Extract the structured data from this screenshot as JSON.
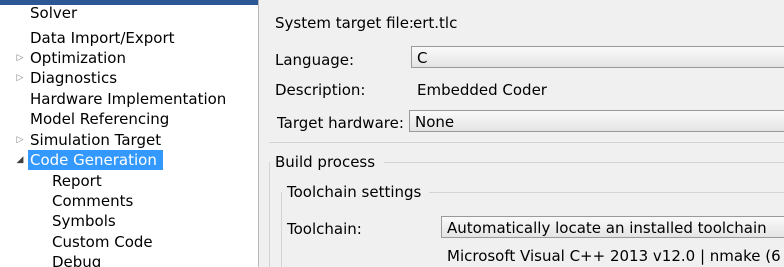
{
  "tree": {
    "items": [
      {
        "label": "Solver",
        "expander": "",
        "indent": 0
      },
      {
        "label": "Data Import/Export",
        "expander": "",
        "indent": 0
      },
      {
        "label": "Optimization",
        "expander": "collapsed",
        "indent": 0
      },
      {
        "label": "Diagnostics",
        "expander": "collapsed",
        "indent": 0
      },
      {
        "label": "Hardware Implementation",
        "expander": "",
        "indent": 0
      },
      {
        "label": "Model Referencing",
        "expander": "",
        "indent": 0
      },
      {
        "label": "Simulation Target",
        "expander": "collapsed",
        "indent": 0
      },
      {
        "label": "Code Generation",
        "expander": "expanded",
        "indent": 0,
        "selected": true
      },
      {
        "label": "Report",
        "expander": "",
        "indent": 1
      },
      {
        "label": "Comments",
        "expander": "",
        "indent": 1
      },
      {
        "label": "Symbols",
        "expander": "",
        "indent": 1
      },
      {
        "label": "Custom Code",
        "expander": "",
        "indent": 1
      },
      {
        "label": "Debug",
        "expander": "",
        "indent": 1
      }
    ]
  },
  "target": {
    "system_target_label": "System target file:",
    "system_target_value": "ert.tlc",
    "language_label": "Language:",
    "language_value": "C",
    "description_label": "Description:",
    "description_value": "Embedded Coder",
    "hardware_label": "Target hardware:",
    "hardware_value": "None"
  },
  "build": {
    "group_title": "Build process",
    "toolchain_group_title": "Toolchain settings",
    "toolchain_label": "Toolchain:",
    "toolchain_value": "Automatically locate an installed toolchain",
    "toolchain_detail": "Microsoft Visual C++ 2013 v12.0 | nmake (6"
  },
  "colors": {
    "selection": "#3399ff",
    "title_bar": "#2b5797"
  }
}
